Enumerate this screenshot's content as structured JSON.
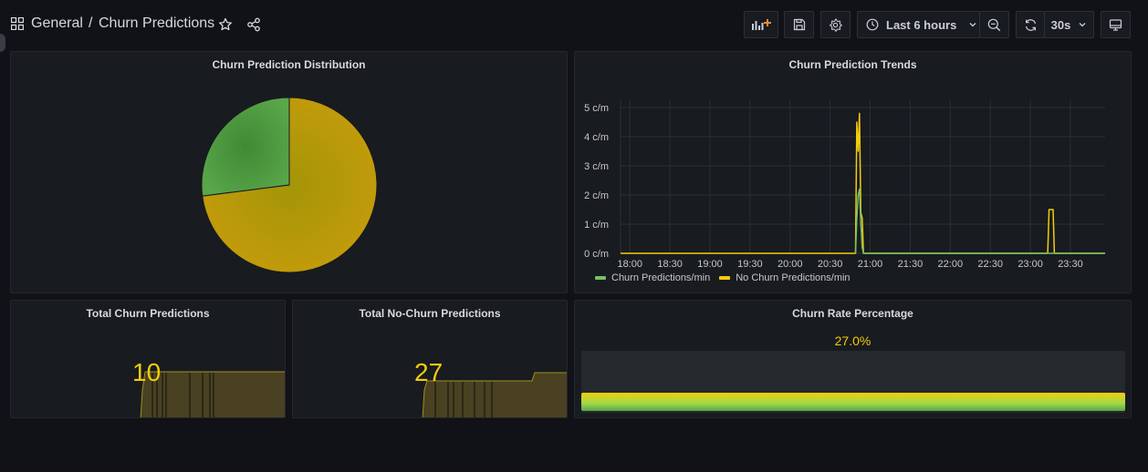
{
  "header": {
    "folder": "General",
    "separator": "/",
    "title": "Churn Predictions",
    "time_range": "Last 6 hours",
    "refresh_interval": "30s"
  },
  "panels": {
    "distribution": {
      "title": "Churn Prediction Distribution"
    },
    "trends": {
      "title": "Churn Prediction Trends",
      "legend": [
        "Churn Predictions/min",
        "No Churn Predictions/min"
      ]
    },
    "total_churn": {
      "title": "Total Churn Predictions",
      "value": "10"
    },
    "total_no_churn": {
      "title": "Total No-Churn Predictions",
      "value": "27"
    },
    "churn_rate": {
      "title": "Churn Rate Percentage",
      "value": "27.0%",
      "fraction": 0.27
    }
  },
  "colors": {
    "churn": "#56a64b",
    "no_churn": "#f2cc0c",
    "background": "#111217",
    "panel": "#181b1f"
  },
  "chart_data": [
    {
      "type": "pie",
      "title": "Churn Prediction Distribution",
      "series": [
        {
          "name": "Churn Predictions",
          "value": 10
        },
        {
          "name": "No Churn Predictions",
          "value": 27
        }
      ]
    },
    {
      "type": "line",
      "title": "Churn Prediction Trends",
      "x_ticks": [
        "18:00",
        "18:30",
        "19:00",
        "19:30",
        "20:00",
        "20:30",
        "21:00",
        "21:30",
        "22:00",
        "22:30",
        "23:00",
        "23:30"
      ],
      "y_ticks": [
        "0 c/m",
        "1 c/m",
        "2 c/m",
        "3 c/m",
        "4 c/m",
        "5 c/m"
      ],
      "ylim": [
        0,
        5
      ],
      "xlim": [
        "17:53",
        "23:56"
      ],
      "grid": true,
      "legend_position": "bottom-left",
      "series": [
        {
          "name": "Churn Predictions/min",
          "points": [
            [
              "20:49",
              0
            ],
            [
              "20:50",
              1.2
            ],
            [
              "20:51",
              2.0
            ],
            [
              "20:52",
              2.2
            ],
            [
              "20:53",
              1.0
            ],
            [
              "20:54",
              0.2
            ],
            [
              "20:55",
              0
            ],
            [
              "23:56",
              0
            ]
          ]
        },
        {
          "name": "No Churn Predictions/min",
          "points": [
            [
              "17:53",
              0
            ],
            [
              "20:49",
              0
            ],
            [
              "20:50",
              4.5
            ],
            [
              "20:51",
              3.5
            ],
            [
              "20:52",
              4.8
            ],
            [
              "20:53",
              1.4
            ],
            [
              "20:54",
              1.2
            ],
            [
              "20:55",
              0
            ],
            [
              "23:13",
              0
            ],
            [
              "23:14",
              1.5
            ],
            [
              "23:17",
              1.5
            ],
            [
              "23:18",
              0
            ],
            [
              "23:56",
              0
            ]
          ]
        }
      ]
    }
  ]
}
